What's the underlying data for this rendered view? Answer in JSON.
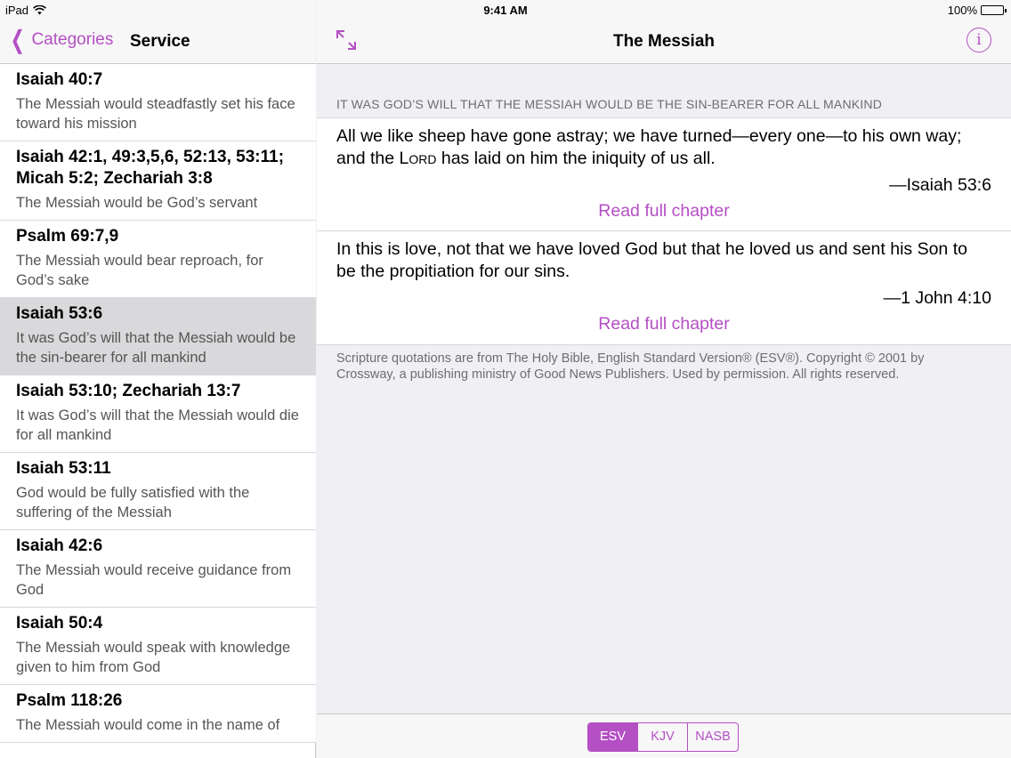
{
  "status_bar": {
    "device": "iPad",
    "time": "9:41 AM",
    "battery": "100%"
  },
  "master": {
    "back_label": "Categories",
    "title": "Service",
    "items": [
      {
        "ref": "Isaiah 40:7",
        "desc": "The Messiah would steadfastly set his face toward his mission"
      },
      {
        "ref": "Isaiah 42:1, 49:3,5,6, 52:13, 53:11; Micah 5:2; Zechariah 3:8",
        "desc": "The Messiah would be God’s servant"
      },
      {
        "ref": "Psalm 69:7,9",
        "desc": "The Messiah would bear reproach, for God’s sake"
      },
      {
        "ref": "Isaiah 53:6",
        "desc": "It was God’s will that the Messiah would be the sin-bearer for all mankind"
      },
      {
        "ref": "Isaiah 53:10; Zechariah 13:7",
        "desc": "It was God’s will that the Messiah would die for all mankind"
      },
      {
        "ref": "Isaiah 53:11",
        "desc": "God would be fully satisfied with the suffering of the Messiah"
      },
      {
        "ref": "Isaiah 42:6",
        "desc": "The Messiah would receive guidance from God"
      },
      {
        "ref": "Isaiah 50:4",
        "desc": "The Messiah would speak with knowledge given to him from God"
      },
      {
        "ref": "Psalm 118:26",
        "desc": "The Messiah would come in the name of"
      }
    ]
  },
  "detail": {
    "title": "The Messiah",
    "section_header": "IT WAS GOD’S WILL THAT THE MESSIAH WOULD BE THE SIN-BEARER FOR ALL MANKIND",
    "verses": [
      {
        "text_before": "All we like sheep have gone astray; we have turned—every one—to his own way; and the ",
        "lord": "Lord",
        "text_after": " has laid on him the iniquity of us all.",
        "ref": "—Isaiah 53:6",
        "link": "Read full chapter"
      },
      {
        "text": "In this is love, not that we have loved God but that he loved us and sent his Son to be the propitiation for our sins.",
        "ref": "—1 John 4:10",
        "link": "Read full chapter"
      }
    ],
    "copyright": "Scripture quotations are from The Holy Bible, English Standard Version® (ESV®). Copyright © 2001 by Crossway, a publishing ministry of Good News Publishers. Used by permission. All rights reserved.",
    "translations": [
      "ESV",
      "KJV",
      "NASB"
    ],
    "selected_translation": "ESV"
  },
  "colors": {
    "accent": "#b44fc4",
    "selected_row": "#d9d9dc",
    "background": "#efeff4"
  }
}
